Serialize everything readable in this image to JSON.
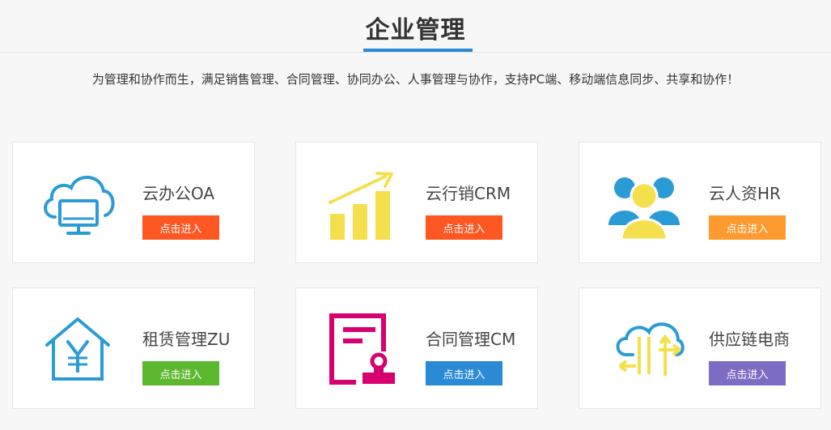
{
  "page": {
    "title": "企业管理",
    "subtitle": "为管理和协作而生，满足销售管理、合同管理、协同办公、人事管理与协作，支持PC端、移动端信息同步、共享和协作！",
    "accent_color": "#2b8ad6"
  },
  "cards": [
    {
      "name": "云办公OA",
      "button_label": "点击进入",
      "button_color": "#ff5722",
      "icon": "cloud-monitor-icon",
      "icon_color": "#2b9bd6"
    },
    {
      "name": "云行销CRM",
      "button_label": "点击进入",
      "button_color": "#ff5722",
      "icon": "bar-chart-growth-icon",
      "icon_color": "#f4e04d"
    },
    {
      "name": "云人资HR",
      "button_label": "点击进入",
      "button_color": "#ff9a2e",
      "icon": "users-group-icon",
      "icon_color": "#2b9bd6"
    },
    {
      "name": "租赁管理ZU",
      "button_label": "点击进入",
      "button_color": "#5cb82e",
      "icon": "house-yen-icon",
      "icon_color": "#2b9bd6"
    },
    {
      "name": "合同管理CM",
      "button_label": "点击进入",
      "button_color": "#2b8ad6",
      "icon": "contract-stamp-icon",
      "icon_color": "#d6006e"
    },
    {
      "name": "供应链电商",
      "button_label": "点击进入",
      "button_color": "#7e6bc4",
      "icon": "cloud-transfer-icon",
      "icon_color": "#2b9bd6"
    }
  ]
}
